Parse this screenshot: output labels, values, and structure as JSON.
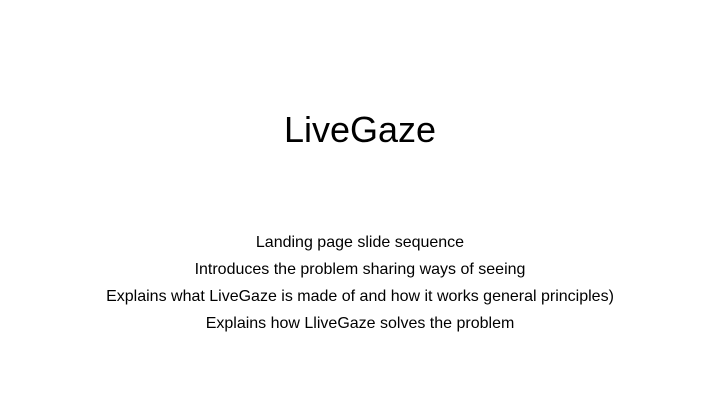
{
  "slide": {
    "title": "LiveGaze",
    "lines": [
      "Landing page slide sequence",
      "Introduces the problem sharing ways of seeing",
      "Explains what LiveGaze is made of and how it works general principles)",
      "Explains how LliveGaze solves the problem"
    ]
  },
  "colors": {
    "background": "#ffffff",
    "text": "#000000"
  }
}
